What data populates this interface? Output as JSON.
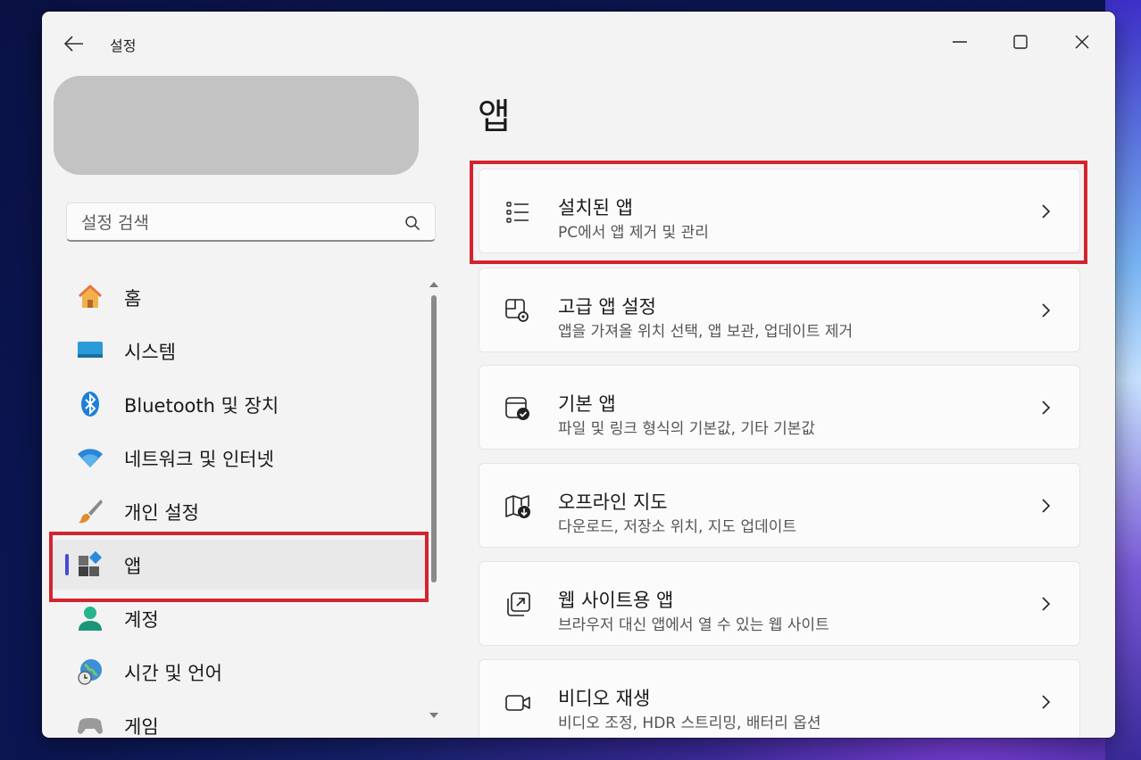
{
  "window": {
    "title": "설정"
  },
  "search": {
    "placeholder": "설정 검색"
  },
  "sidebar": {
    "items": [
      {
        "label": "홈",
        "icon": "home-icon"
      },
      {
        "label": "시스템",
        "icon": "system-icon"
      },
      {
        "label": "Bluetooth 및 장치",
        "icon": "bluetooth-icon"
      },
      {
        "label": "네트워크 및 인터넷",
        "icon": "wifi-icon"
      },
      {
        "label": "개인 설정",
        "icon": "brush-icon"
      },
      {
        "label": "앱",
        "icon": "apps-icon",
        "selected": true
      },
      {
        "label": "계정",
        "icon": "account-icon"
      },
      {
        "label": "시간 및 언어",
        "icon": "globe-clock-icon"
      },
      {
        "label": "게임",
        "icon": "game-controller-icon"
      }
    ]
  },
  "main": {
    "title": "앱",
    "cards": [
      {
        "title": "설치된 앱",
        "desc": "PC에서 앱 제거 및 관리",
        "icon": "list-icon"
      },
      {
        "title": "고급 앱 설정",
        "desc": "앱을 가져올 위치 선택, 앱 보관, 업데이트 제거",
        "icon": "app-settings-icon"
      },
      {
        "title": "기본 앱",
        "desc": "파일 및 링크 형식의 기본값, 기타 기본값",
        "icon": "default-app-check-icon"
      },
      {
        "title": "오프라인 지도",
        "desc": "다운로드, 저장소 위치, 지도 업데이트",
        "icon": "map-download-icon"
      },
      {
        "title": "웹 사이트용 앱",
        "desc": "브라우저 대신 앱에서 열 수 있는 웹 사이트",
        "icon": "open-external-icon"
      },
      {
        "title": "비디오 재생",
        "desc": "비디오 조정, HDR 스트리밍, 배터리 옵션",
        "icon": "video-camera-icon"
      }
    ]
  },
  "colors": {
    "highlight": "#d3242e",
    "accent": "#4a48d6",
    "window_bg": "#f3f3f3"
  }
}
